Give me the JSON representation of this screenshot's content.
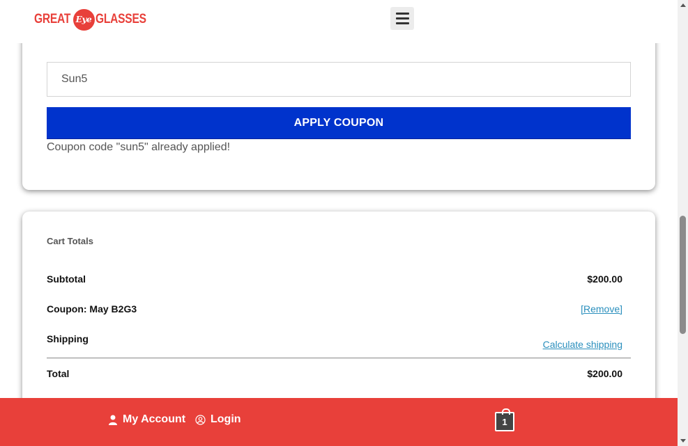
{
  "header": {
    "logo": {
      "word1": "GREAT",
      "eye": "Eye",
      "word2": "GLASSES"
    },
    "menu_icon": "hamburger-menu-icon"
  },
  "coupon": {
    "input_value": "Sun5",
    "apply_label": "APPLY COUPON",
    "message": "Coupon code \"sun5\" already applied!",
    "button_color": "#0033cc"
  },
  "totals": {
    "title": "Cart Totals",
    "subtotal_label": "Subtotal",
    "subtotal_value": "$200.00",
    "coupon_label": "Coupon: May B2G3",
    "coupon_remove": "[Remove]",
    "shipping_label": "Shipping",
    "shipping_link": "Calculate shipping",
    "total_label": "Total",
    "total_value": "$200.00"
  },
  "footer": {
    "account_label": "My Account",
    "account_icon": "user-icon",
    "login_label": "Login",
    "login_icon": "login-circle-icon",
    "cart_count": "1",
    "cart_icon": "shopping-bag-icon",
    "bar_color": "#e8403a"
  }
}
